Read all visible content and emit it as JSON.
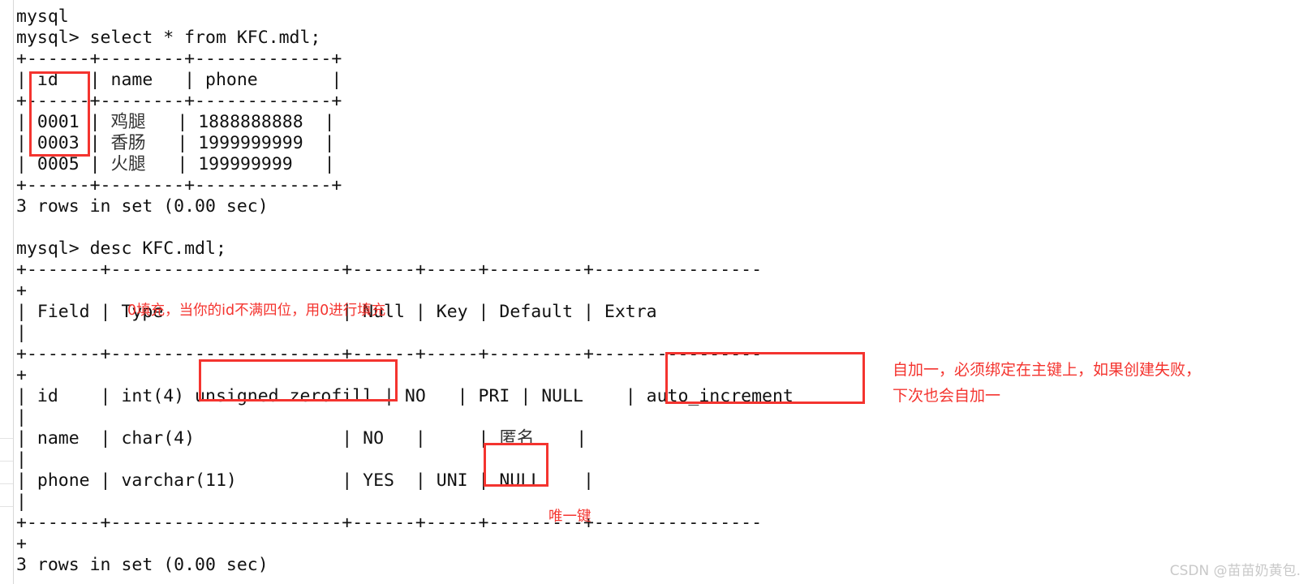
{
  "colors": {
    "annotation_red": "#f4342f",
    "terminal_text": "#111111",
    "background": "#ffffff",
    "gutter_line": "#e3e3e3",
    "watermark": "#c9c9c9"
  },
  "terminal": {
    "partial_top_line": "mysql",
    "lines": [
      "mysql> select * from KFC.mdl;",
      "+------+--------+-------------+",
      "| id   | name   | phone       |",
      "+------+--------+-------------+",
      "| 0001 | 鸡腿   | 1888888888  |",
      "| 0003 | 香肠   | 1999999999  |",
      "| 0005 | 火腿   | 199999999   |",
      "+------+--------+-------------+",
      "3 rows in set (0.00 sec)",
      "",
      "mysql> desc KFC.mdl;",
      "+-------+----------------------+------+-----+---------+----------------",
      "+",
      "| Field | Type                 | Null | Key | Default | Extra",
      "|",
      "+-------+----------------------+------+-----+---------+----------------",
      "+",
      "| id    | int(4) unsigned zerofill | NO   | PRI | NULL    | auto_increment",
      "|",
      "| name  | char(4)              | NO   |     | 匿名    |",
      "|",
      "| phone | varchar(11)          | YES  | UNI | NULL    |",
      "|",
      "+-------+----------------------+------+-----+---------+----------------",
      "+",
      "3 rows in set (0.00 sec)"
    ],
    "queries": [
      "select * from KFC.mdl;",
      "desc KFC.mdl;"
    ],
    "result_table": {
      "columns": [
        "id",
        "name",
        "phone"
      ],
      "rows": [
        [
          "0001",
          "鸡腿",
          "1888888888"
        ],
        [
          "0003",
          "香肠",
          "1999999999"
        ],
        [
          "0005",
          "火腿",
          "199999999"
        ]
      ],
      "footer": "3 rows in set (0.00 sec)"
    },
    "desc_table": {
      "columns": [
        "Field",
        "Type",
        "Null",
        "Key",
        "Default",
        "Extra"
      ],
      "rows": [
        [
          "id",
          "int(4) unsigned zerofill",
          "NO",
          "PRI",
          "NULL",
          "auto_increment"
        ],
        [
          "name",
          "char(4)",
          "NO",
          "",
          "匿名",
          ""
        ],
        [
          "phone",
          "varchar(11)",
          "YES",
          "UNI",
          "NULL",
          ""
        ]
      ],
      "footer": "3 rows in set (0.00 sec)"
    }
  },
  "annotations": {
    "zerofill_note": "0填充，当你的id不满四位，用0进行填充",
    "auto_increment_note_line1": "自加一，必须绑定在主键上，如果创建失败，",
    "auto_increment_note_line2": "下次也会自加一",
    "unique_key_note": "唯一键",
    "highlight_boxes": [
      {
        "name": "id-values-box",
        "label": "0001 0003 0005"
      },
      {
        "name": "unsigned-zerofill-box",
        "label": "unsigned zerofill"
      },
      {
        "name": "auto-increment-box",
        "label": "auto_increment"
      },
      {
        "name": "uni-box",
        "label": "UNI"
      }
    ]
  },
  "watermark": {
    "text": "CSDN @苗苗奶黄包."
  }
}
